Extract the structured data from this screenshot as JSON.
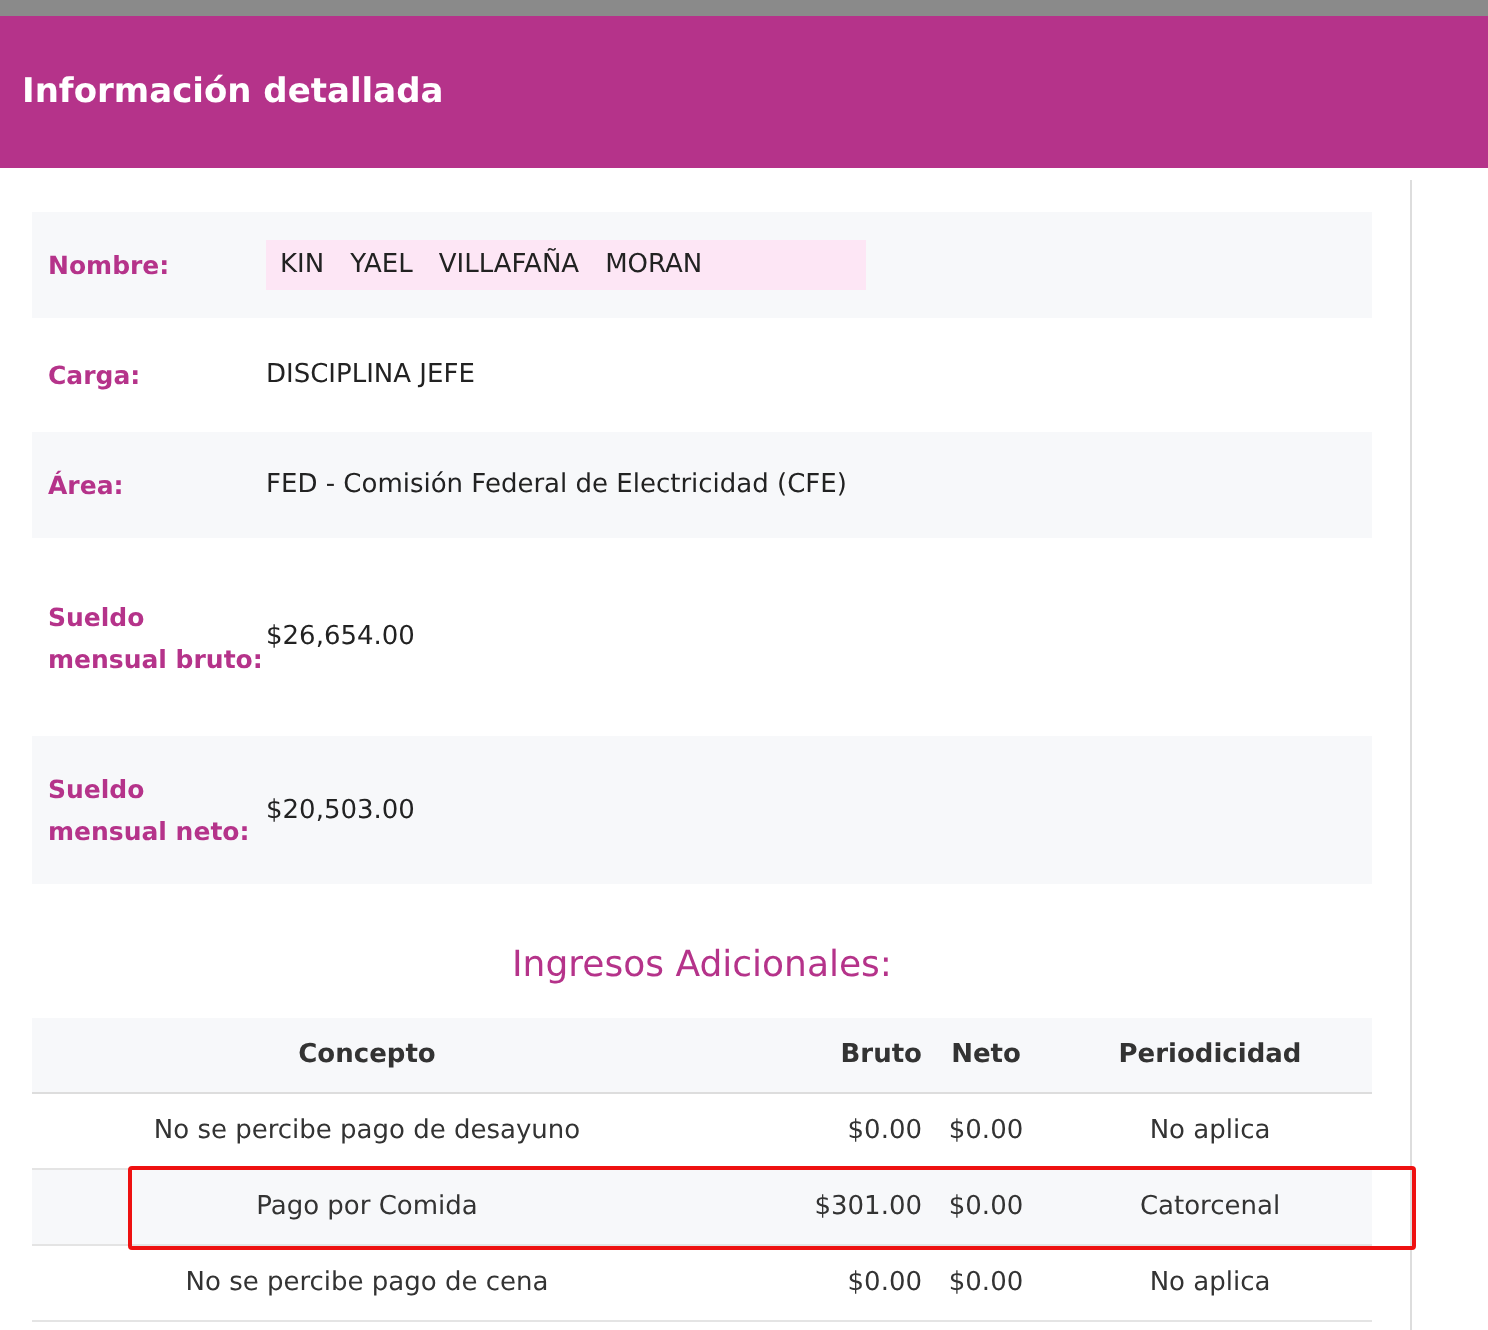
{
  "modal": {
    "title": "Información detallada"
  },
  "details": [
    {
      "label": "Nombre:",
      "kind": "name",
      "value": [
        "KIN",
        "YAEL",
        "VILLAFAÑA",
        "MORAN"
      ]
    },
    {
      "label": "Carga:",
      "kind": "text",
      "value": "DISCIPLINA JEFE"
    },
    {
      "label": "Área:",
      "kind": "text",
      "value": "FED - Comisión Federal de Electricidad (CFE)"
    },
    {
      "label": "Sueldo mensual bruto:",
      "kind": "text",
      "value": "$26,654.00"
    },
    {
      "label": "Sueldo mensual neto:",
      "kind": "text",
      "value": "$20,503.00"
    }
  ],
  "section_title": "Ingresos Adicionales:",
  "table": {
    "columns": [
      "Concepto",
      "Bruto",
      "Neto",
      "Periodicidad"
    ],
    "rows": [
      {
        "cells": [
          "No se percibe pago de desayuno",
          "$0.00",
          "$0.00",
          "No aplica"
        ],
        "highlighted": false
      },
      {
        "cells": [
          "Pago por Comida",
          "$301.00",
          "$0.00",
          "Catorcenal"
        ],
        "highlighted": true
      },
      {
        "cells": [
          "No se percibe pago de cena",
          "$0.00",
          "$0.00",
          "No aplica"
        ],
        "highlighted": false
      }
    ]
  }
}
